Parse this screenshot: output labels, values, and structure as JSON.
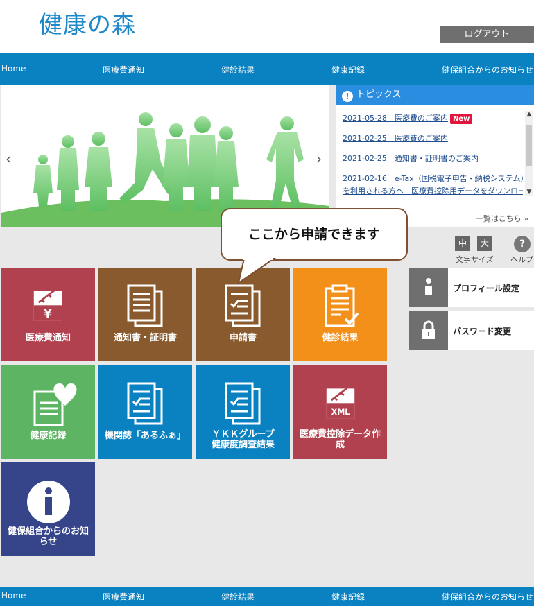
{
  "header": {
    "logo": "健康の森",
    "logout_label": "ログアウト"
  },
  "nav": [
    "Home",
    "医療費通知",
    "健診結果",
    "健康記録",
    "健保組合からのお知らせ"
  ],
  "topics": {
    "title": "トピックス",
    "items": [
      {
        "text": "2021-05-28　医療費のご案内",
        "badge": "New"
      },
      {
        "text": "2021-02-25　医療費のご案内"
      },
      {
        "text": "2021-02-25　通知書・証明書のご案内"
      },
      {
        "text": "2021-02-16　e-Tax（国税電子申告・納税システム）",
        "text2": "を利用される方へ　医療費控除用データをダウンロード"
      }
    ],
    "more_label": "一覧はこちら"
  },
  "callout": {
    "text": "ここから申請できます"
  },
  "font_size": {
    "medium": "中",
    "large": "大",
    "label": "文字サイズ"
  },
  "help": {
    "label": "ヘルプ"
  },
  "tiles": [
    {
      "label": "医療費通知",
      "color": "#b2414f",
      "icon": "medical-yen-icon"
    },
    {
      "label": "通知書・証明書",
      "color": "#885a2e",
      "icon": "documents-icon"
    },
    {
      "label": "申請書",
      "color": "#885a2e",
      "icon": "application-form-icon"
    },
    {
      "label": "健診結果",
      "color": "#f39019",
      "icon": "clipboard-check-icon"
    },
    {
      "label": "健康記録",
      "color": "#5db563",
      "icon": "heart-record-icon"
    },
    {
      "label": "機関誌「あるふぁ」",
      "color": "#0a81c1",
      "icon": "magazine-icon"
    },
    {
      "label": "ＹＫＫグループ",
      "label2": "健康度調査結果",
      "color": "#0a81c1",
      "icon": "survey-icon"
    },
    {
      "label": "医療費控除データ作",
      "label2": "成",
      "color": "#b2414f",
      "icon": "xml-file-icon",
      "icon_text": "XML"
    },
    {
      "label": "健保組合からのお知",
      "label2": "らせ",
      "color": "#36448a",
      "icon": "info-icon"
    }
  ],
  "side_buttons": [
    {
      "label": "プロフィール設定",
      "icon": "person-icon"
    },
    {
      "label": "パスワード変更",
      "icon": "lock-icon"
    }
  ]
}
